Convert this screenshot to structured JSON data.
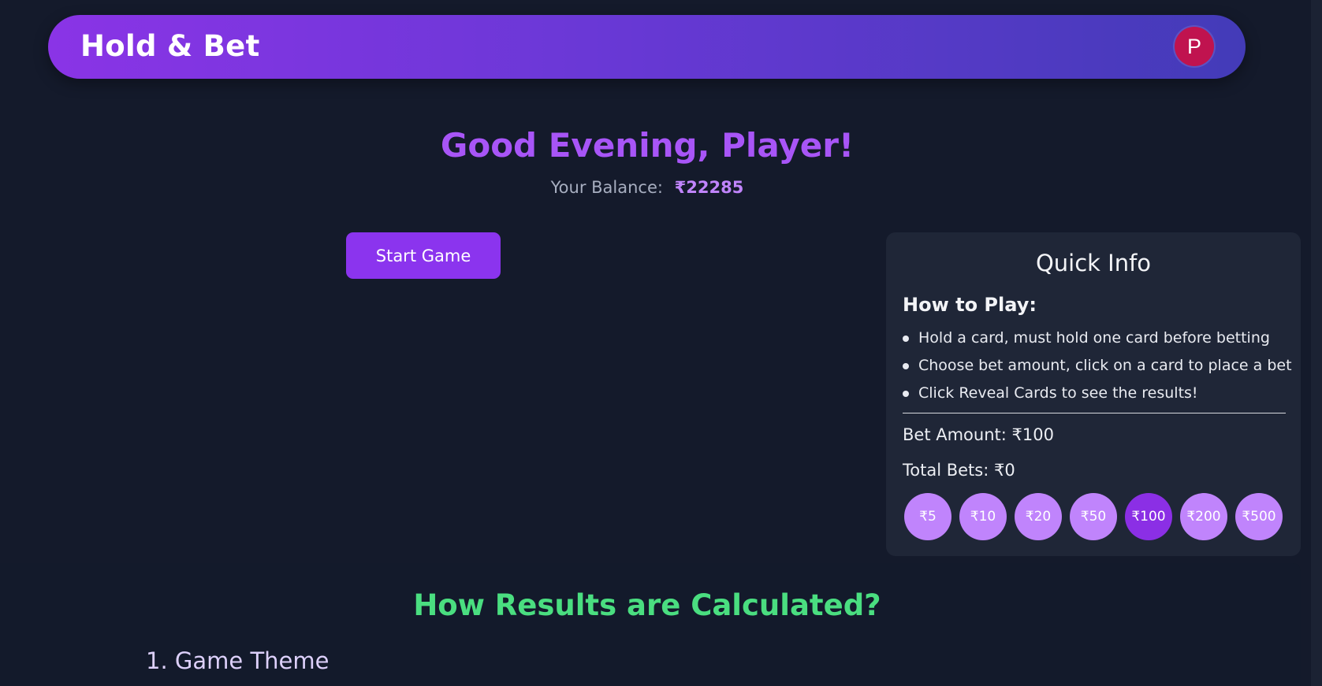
{
  "header": {
    "brand": "Hold & Bet",
    "avatar_letter": "P"
  },
  "welcome": {
    "greeting": "Good Evening, Player!",
    "balance_label": "Your Balance:",
    "balance_value": "₹22285"
  },
  "actions": {
    "start_game_label": "Start Game"
  },
  "quick_info": {
    "title": "Quick Info",
    "how_to_play_title": "How to Play:",
    "steps": [
      "Hold a card, must hold one card before betting",
      "Choose bet amount, click on a card to place a bet",
      "Click Reveal Cards to see the results!"
    ],
    "bet_amount": "Bet Amount: ₹100",
    "total_bets": "Total Bets: ₹0",
    "chips": [
      "₹5",
      "₹10",
      "₹20",
      "₹50",
      "₹100",
      "₹200",
      "₹500"
    ],
    "selected_chip": "₹100"
  },
  "results": {
    "title": "How Results are Calculated?",
    "section_1": "1. Game Theme"
  },
  "colors": {
    "background": "#141a2b",
    "header_gradient_start": "#8a34e6",
    "header_gradient_end": "#433bb8",
    "accent_purple": "#a855f7",
    "chip": "#c084fc",
    "chip_selected": "#8b2fe5",
    "results_title": "#4ade80",
    "avatar": "#c0134f"
  }
}
